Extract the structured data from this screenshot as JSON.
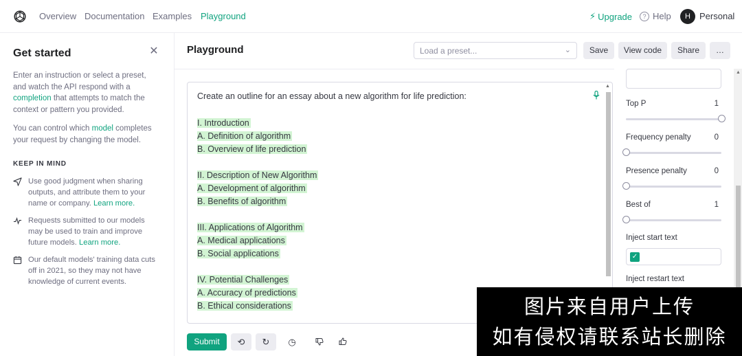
{
  "nav": {
    "links": [
      "Overview",
      "Documentation",
      "Examples",
      "Playground"
    ],
    "upgrade": "Upgrade",
    "help": "Help",
    "avatar_initial": "H",
    "account": "Personal"
  },
  "sidebar": {
    "title": "Get started",
    "intro_pre": "Enter an instruction or select a preset, and watch the API respond with a ",
    "intro_link": "completion",
    "intro_post": " that attempts to match the context or pattern you provided.",
    "model_pre": "You can control which ",
    "model_link": "model",
    "model_post": " completes your request by changing the model.",
    "keep_in_mind": "KEEP IN MIND",
    "items": [
      {
        "text": "Use good judgment when sharing outputs, and attribute them to your name or company. ",
        "link": "Learn more."
      },
      {
        "text": "Requests submitted to our models may be used to train and improve future models. ",
        "link": "Learn more."
      },
      {
        "text": "Our default models' training data cuts off in 2021, so they may not have knowledge of current events.",
        "link": ""
      }
    ]
  },
  "main": {
    "title": "Playground",
    "preset_placeholder": "Load a preset...",
    "buttons": {
      "save": "Save",
      "view_code": "View code",
      "share": "Share",
      "more": "…"
    },
    "prompt": "Create an outline for an essay about a new algorithm for life prediction:",
    "completion": [
      "I. Introduction",
      "A. Definition of algorithm",
      "B. Overview of life prediction",
      "",
      "II. Description of New Algorithm",
      "A. Development of algorithm",
      "B. Benefits of algorithm",
      "",
      "III. Applications of Algorithm",
      "A. Medical applications",
      "B. Social applications",
      "",
      "IV. Potential Challenges",
      "A. Accuracy of predictions",
      "B. Ethical considerations"
    ],
    "submit": "Submit"
  },
  "settings": {
    "top_p": {
      "label": "Top P",
      "value": "1",
      "level": 1.0
    },
    "frequency_penalty": {
      "label": "Frequency penalty",
      "value": "0",
      "level": 0.0
    },
    "presence_penalty": {
      "label": "Presence penalty",
      "value": "0",
      "level": 0.0
    },
    "best_of": {
      "label": "Best of",
      "value": "1",
      "level": 0.0
    },
    "inject_start_text": {
      "label": "Inject start text",
      "checked": true
    },
    "inject_restart_text": {
      "label": "Inject restart text"
    }
  },
  "watermark": {
    "line1": "图片来自用户上传",
    "line2": "如有侵权请联系站长删除"
  },
  "colors": {
    "accent": "#10a37f",
    "highlight": "#d2f4d3"
  }
}
